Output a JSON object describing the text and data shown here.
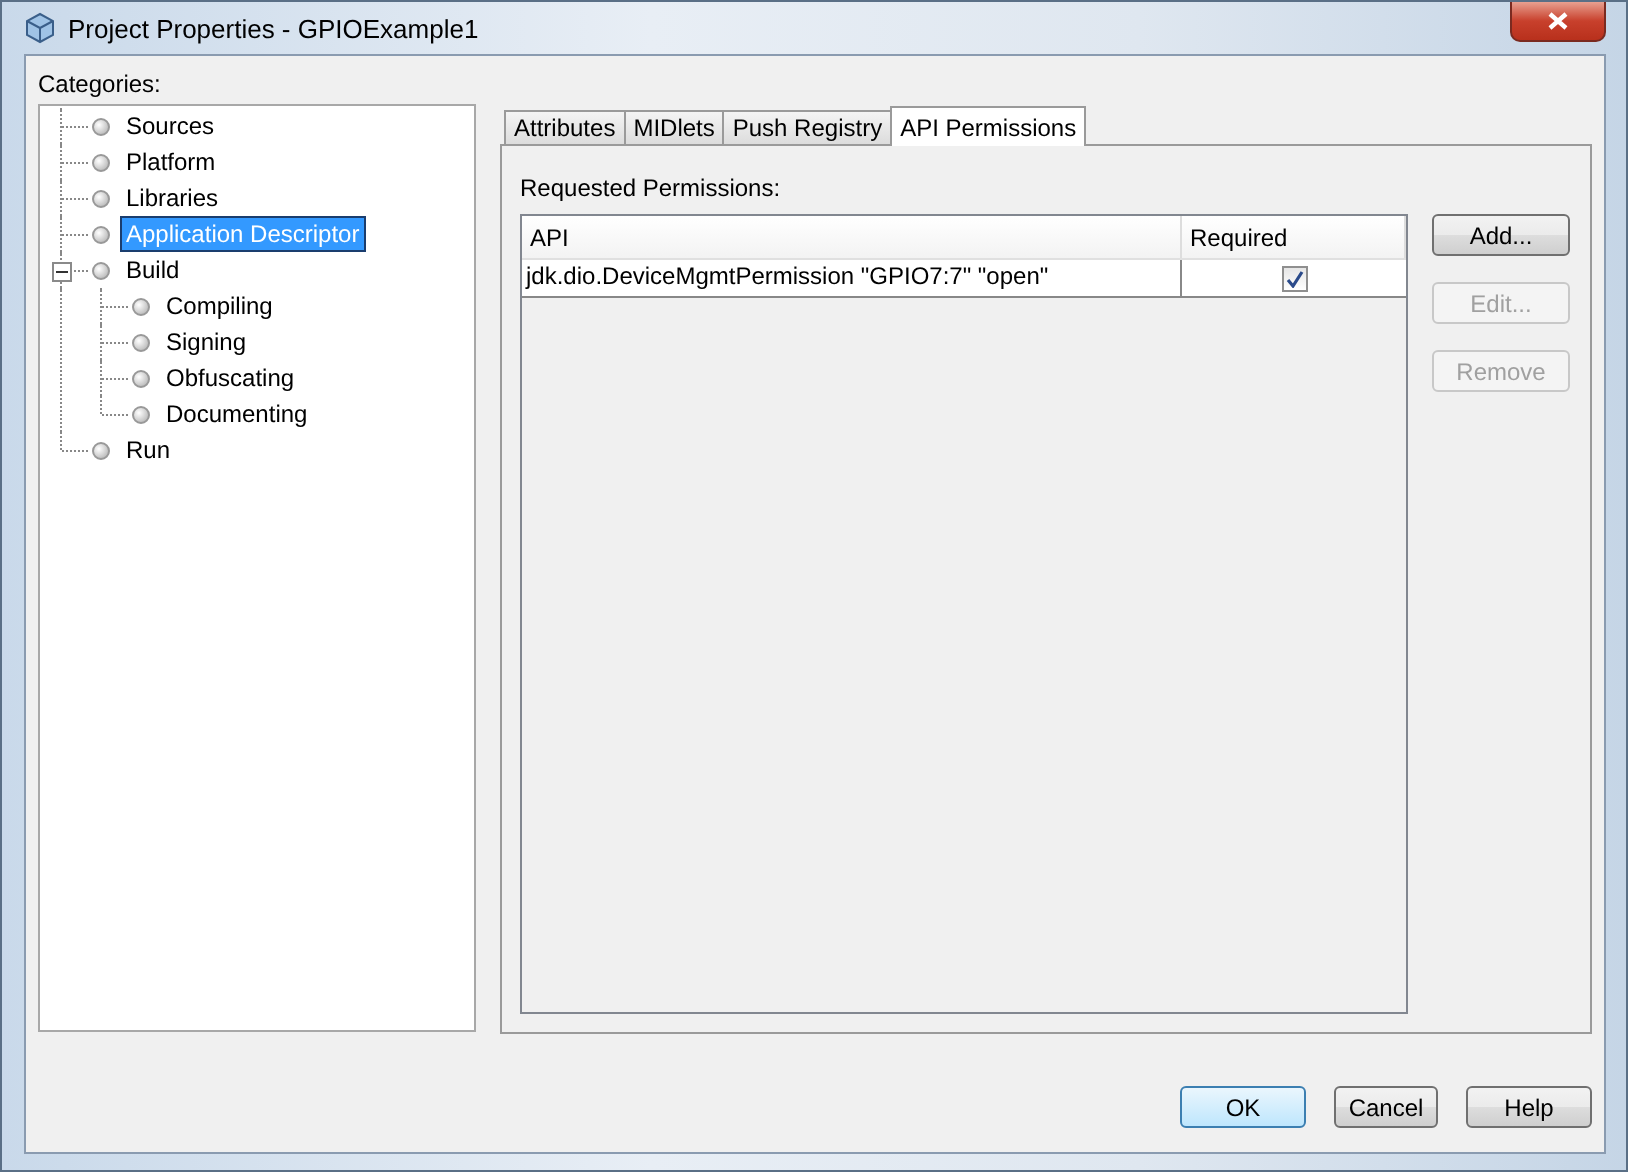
{
  "window": {
    "title": "Project Properties - GPIOExample1"
  },
  "categories": {
    "label": "Categories:",
    "items": [
      {
        "label": "Sources",
        "selected": false
      },
      {
        "label": "Platform",
        "selected": false
      },
      {
        "label": "Libraries",
        "selected": false
      },
      {
        "label": "Application Descriptor",
        "selected": true
      },
      {
        "label": "Build",
        "selected": false,
        "expanded": true,
        "children": [
          {
            "label": "Compiling",
            "selected": false
          },
          {
            "label": "Signing",
            "selected": false
          },
          {
            "label": "Obfuscating",
            "selected": false
          },
          {
            "label": "Documenting",
            "selected": false
          }
        ]
      },
      {
        "label": "Run",
        "selected": false
      }
    ]
  },
  "tabs": [
    {
      "label": "Attributes",
      "selected": false
    },
    {
      "label": "MIDlets",
      "selected": false
    },
    {
      "label": "Push Registry",
      "selected": false
    },
    {
      "label": "API Permissions",
      "selected": true
    }
  ],
  "permissions": {
    "label": "Requested Permissions:",
    "columns": [
      "API",
      "Required"
    ],
    "rows": [
      {
        "api": "jdk.dio.DeviceMgmtPermission \"GPIO7:7\" \"open\"",
        "required": true
      }
    ]
  },
  "side_buttons": [
    {
      "label": "Add...",
      "disabled": false
    },
    {
      "label": "Edit...",
      "disabled": true
    },
    {
      "label": "Remove",
      "disabled": true
    }
  ],
  "footer_buttons": [
    {
      "label": "OK",
      "focused": true
    },
    {
      "label": "Cancel",
      "focused": false
    },
    {
      "label": "Help",
      "focused": false
    }
  ]
}
